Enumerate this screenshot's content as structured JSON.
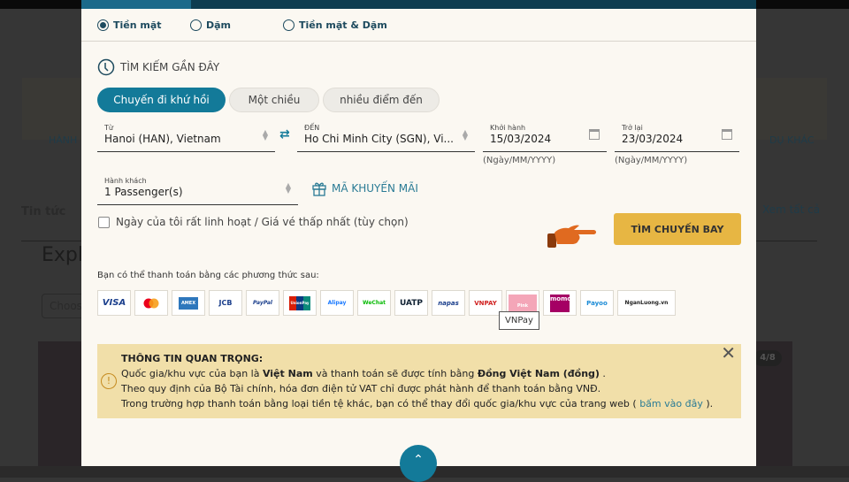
{
  "background": {
    "service_left": "HÀNH",
    "service_right": "DỤ KHÁC",
    "news": "Tin tức",
    "see_all": "Xem tất cả",
    "explore": "Explo",
    "choose": "Choos",
    "badge": "4/8"
  },
  "fare_type": {
    "options": [
      {
        "label": "Tiền mặt",
        "selected": true
      },
      {
        "label": "Dặm",
        "selected": false
      },
      {
        "label": "Tiền mặt & Dặm",
        "selected": false
      }
    ]
  },
  "recent_search": "TÌM KIẾM GẦN ĐÂY",
  "trip_tabs": [
    {
      "label": "Chuyến đi khứ hồi",
      "active": true
    },
    {
      "label": "Một chiều",
      "active": false
    },
    {
      "label": "nhiều điểm đến",
      "active": false
    }
  ],
  "from": {
    "label": "Từ",
    "value": "Hanoi (HAN), Vietnam"
  },
  "to": {
    "label": "ĐẾN",
    "value": "Ho Chi Minh City (SGN), Vi..."
  },
  "depart": {
    "label": "Khởi hành",
    "value": "15/03/2024",
    "hint": "(Ngày/MM/YYYY)"
  },
  "return": {
    "label": "Trở lại",
    "value": "23/03/2024",
    "hint": "(Ngày/MM/YYYY)"
  },
  "passengers": {
    "label": "Hành khách",
    "value": "1 Passenger(s)"
  },
  "promo": "MÃ KHUYẾN MÃI",
  "flexible": "Ngày của tôi rất linh hoạt / Giá vé thấp nhất (tùy chọn)",
  "search_button": "TÌM CHUYẾN BAY",
  "payment": {
    "label": "Bạn có thể thanh toán bằng các phương thức sau:",
    "methods": [
      "VISA",
      "MC",
      "AMEX",
      "JCB",
      "PayPal",
      "UnionPay",
      "Alipay",
      "WeChat",
      "UATP",
      "napas",
      "VNPAY",
      "Pink",
      "momo",
      "Payoo",
      "NganLuong.vn"
    ],
    "tooltip": "VNPay"
  },
  "notice": {
    "title": "THÔNG TIN QUAN TRỌNG:",
    "l1a": "Quốc gia/khu vực của bạn là ",
    "l1b": "Việt Nam",
    "l1c": " và thanh toán sẽ được tính bằng ",
    "l1d": "Đồng Việt Nam (đồng)",
    "l1e": " .",
    "l2": "Theo quy định của Bộ Tài chính, hóa đơn điện tử VAT chỉ được phát hành để thanh toán bằng VNĐ.",
    "l3a": "Trong trường hợp thanh toán bằng loại tiền tệ khác, bạn có thể thay đổi quốc gia/khu vực của trang web ( ",
    "l3b": "bấm vào đây",
    "l3c": " )."
  },
  "colors": {
    "primary": "#137a99",
    "search": "#e7b643",
    "notice_bg": "#f1dfa9"
  }
}
